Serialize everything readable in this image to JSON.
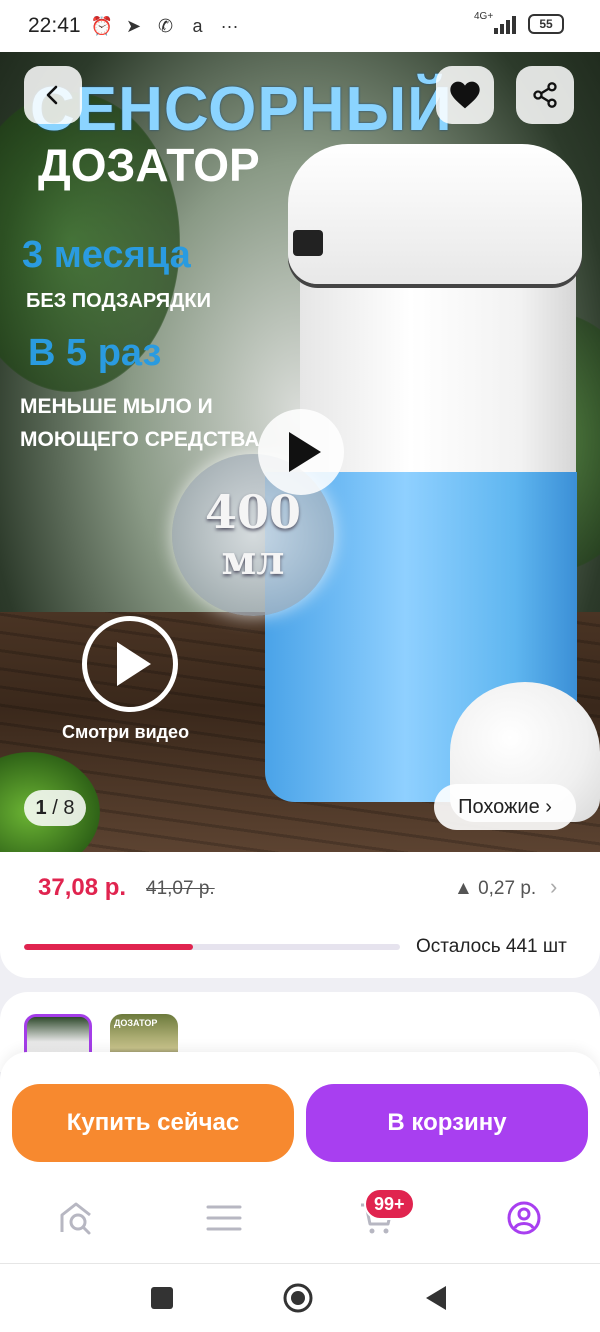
{
  "status_bar": {
    "time": "22:41",
    "network": "4G+",
    "battery": "55"
  },
  "hero": {
    "title": "СЕНСОРНЫЙ",
    "subtitle": "ДОЗАТОР",
    "promo_1": "3 месяца",
    "promo_1_sub": "БЕЗ ПОДЗАРЯДКИ",
    "promo_2": "В 5 раз",
    "promo_2_sub": "МЕНЬШЕ МЫЛО И МОЮЩЕГО СРЕДСТВА",
    "volume_number": "400",
    "volume_unit": "мл",
    "watch_video": "Смотри видео",
    "pager_current": "1",
    "pager_total": "/ 8",
    "similar_label": "Похожие ›"
  },
  "price": {
    "current": "37,08 р.",
    "old": "41,07 р.",
    "change": "▲ 0,27 р.",
    "stock_text": "Осталось 441 шт",
    "stock_fill_fraction": 0.45
  },
  "thumbnails": {
    "thumb_2_text": "ДОЗАТОР"
  },
  "actions": {
    "buy_now": "Купить сейчас",
    "add_to_cart": "В корзину"
  },
  "bottom_nav": {
    "cart_badge": "99+",
    "items": [
      "home-search-icon",
      "catalog-menu-icon",
      "cart-icon",
      "profile-icon"
    ],
    "active_color": "#a83ff0"
  },
  "colors": {
    "price": "#e0244f",
    "buy_button": "#f7892f",
    "cart_button": "#a83ff0"
  }
}
